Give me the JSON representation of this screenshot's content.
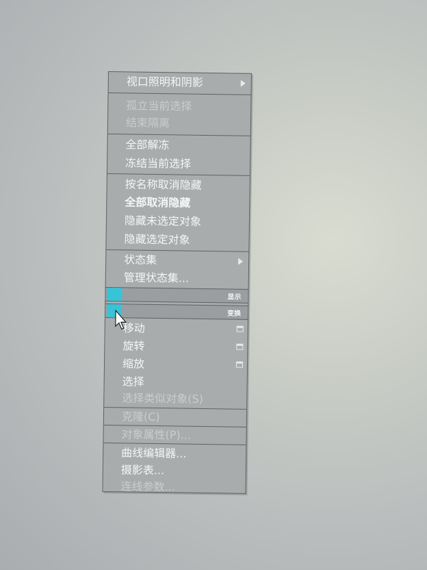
{
  "menu": {
    "items": [
      {
        "label": "视口照明和阴影",
        "submenu": true
      },
      {
        "label": "孤立当前选择",
        "disabled": true
      },
      {
        "label": "结束隔离",
        "disabled": true
      },
      {
        "label": "全部解冻"
      },
      {
        "label": "冻结当前选择"
      },
      {
        "label": "按名称取消隐藏"
      },
      {
        "label": "全部取消隐藏",
        "bold": true
      },
      {
        "label": "隐藏未选定对象"
      },
      {
        "label": "隐藏选定对象"
      },
      {
        "label": "状态集",
        "submenu": true
      },
      {
        "label": "管理状态集..."
      },
      {
        "label": "移动",
        "options": true
      },
      {
        "label": "旋转",
        "options": true
      },
      {
        "label": "缩放",
        "options": true
      },
      {
        "label": "选择"
      },
      {
        "label": "选择类似对象(S)",
        "disabled": true
      },
      {
        "label": "克隆(C)",
        "disabled": true
      },
      {
        "label": "对象属性(P)...",
        "disabled": true
      },
      {
        "label": "曲线编辑器..."
      },
      {
        "label": "摄影表..."
      },
      {
        "label": "连线参数...",
        "disabled": true
      }
    ],
    "headers": {
      "display": "显示",
      "transform": "变换"
    },
    "accent_color": "#38c3d7"
  }
}
